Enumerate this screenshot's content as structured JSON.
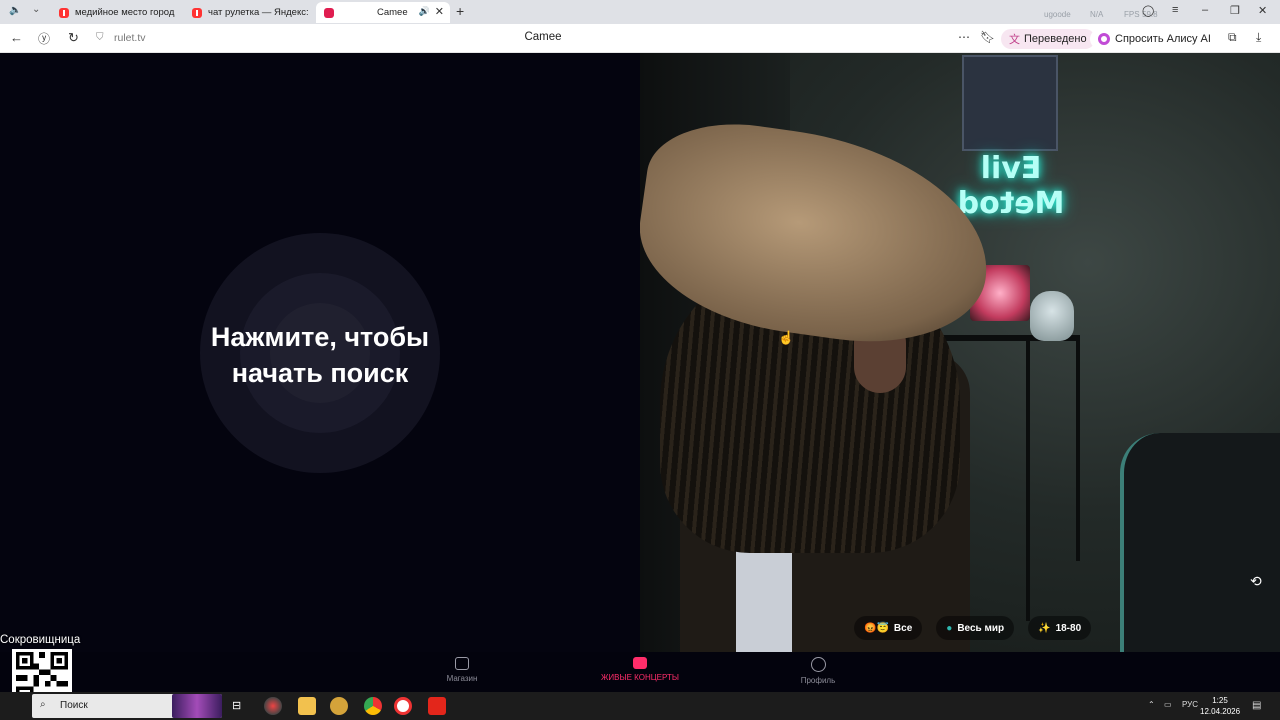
{
  "browser": {
    "tabs": [
      {
        "title": "медийное место город бр",
        "active": false
      },
      {
        "title": "чат рулетка — Яндекс: на",
        "active": false
      },
      {
        "title": "Camee",
        "active": true
      }
    ],
    "address": {
      "url": "rulet.tv"
    },
    "page_title": "Camee",
    "translated_label": "Переведено",
    "alice_label": "Спросить Алису AI",
    "background_faint_text": [
      "ugoode",
      "N/A",
      "FPS",
      "59.8"
    ]
  },
  "left_panel": {
    "cta_line1": "Нажмите, чтобы",
    "cta_line2": "начать поиск"
  },
  "video_overlay": {
    "neon_sign": "Evil Metod",
    "filters": [
      {
        "icon": "emoji-faces-icon",
        "glyph": "😡😇",
        "label": "Все"
      },
      {
        "icon": "globe-icon",
        "glyph": "●",
        "label": "Весь мир"
      },
      {
        "icon": "sparkle-icon",
        "glyph": "✨",
        "label": "18-80"
      }
    ]
  },
  "bottom_nav": [
    {
      "label": "Магазин",
      "active": false
    },
    {
      "label": "ЖИВЫЕ КОНЦЕРТЫ",
      "active": true
    },
    {
      "label": "Профиль",
      "active": false
    }
  ],
  "overlay": {
    "treasure_label": "Сокровищница"
  },
  "taskbar": {
    "search_placeholder": "Поиск",
    "lang": "РУС",
    "time": "1:25",
    "date": "12.04.2026"
  },
  "colors": {
    "accent": "#e01d50",
    "active_nav": "#ff2d6a",
    "translated_bg": "#f7e6f1",
    "neon": "#7ffff0"
  }
}
